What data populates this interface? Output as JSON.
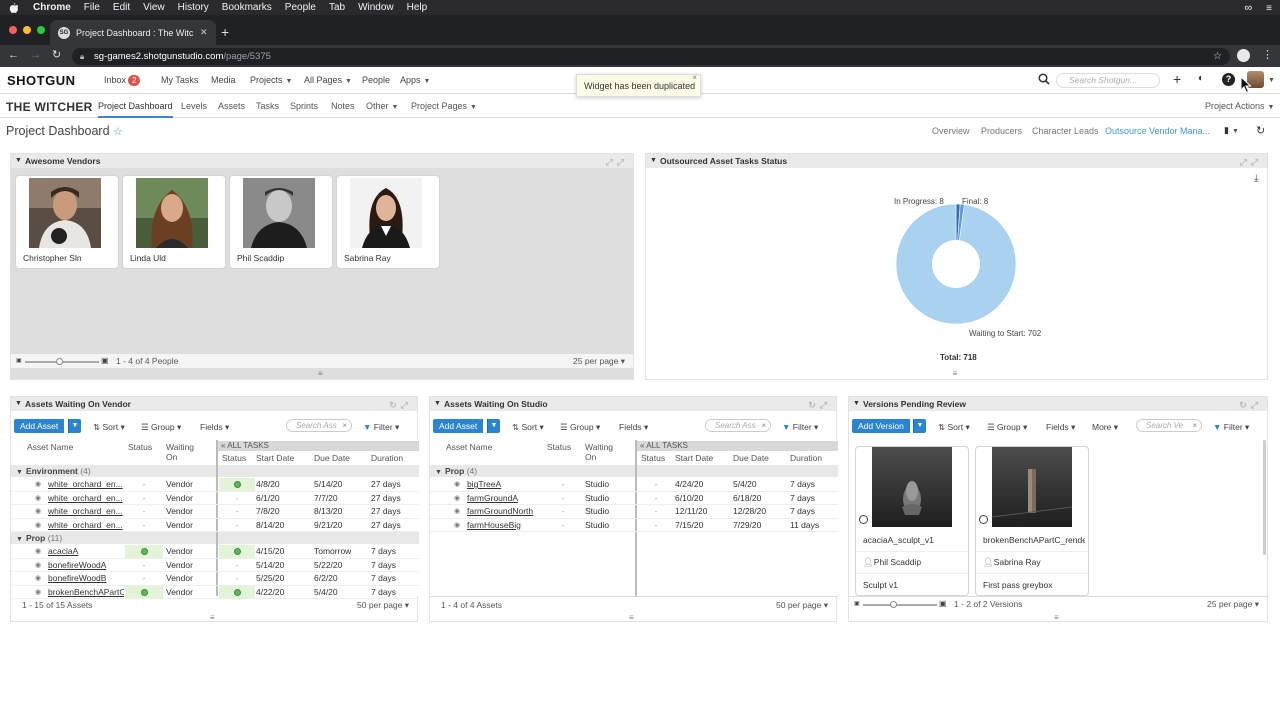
{
  "macos": {
    "app": "Chrome",
    "menus": [
      "File",
      "Edit",
      "View",
      "History",
      "Bookmarks",
      "People",
      "Tab",
      "Window",
      "Help"
    ]
  },
  "browser": {
    "tab_title": "Project Dashboard : The Witch",
    "favicon_text": "SG",
    "url_host": "sg-games2.shotgunstudio.com",
    "url_path": "/page/5375"
  },
  "app": {
    "logo": "SHOTGUN",
    "nav": [
      "Inbox",
      "My Tasks",
      "Media",
      "Projects",
      "All Pages",
      "People",
      "Apps"
    ],
    "inbox_count": "2",
    "search_placeholder": "Search Shotgun...",
    "toast": "Widget has been duplicated"
  },
  "project": {
    "title": "THE WITCHER",
    "tabs": [
      "Project Dashboard",
      "Levels",
      "Assets",
      "Tasks",
      "Sprints",
      "Notes",
      "Other",
      "Project Pages"
    ],
    "actions": "Project Actions"
  },
  "page": {
    "title": "Project Dashboard",
    "links": [
      "Overview",
      "Producers",
      "Character Leads",
      "Outsource Vendor Mana..."
    ]
  },
  "vendors_widget": {
    "title": "Awesome Vendors",
    "people": [
      "Christopher Sln",
      "Linda Uld",
      "Phil Scaddip",
      "Sabrina Ray"
    ],
    "footer_count": "1 - 4 of 4 People",
    "per_page": "25 per page"
  },
  "status_widget": {
    "title": "Outsourced Asset Tasks Status",
    "labels": {
      "in_progress": "In Progress: 8",
      "final": "Final: 8",
      "waiting": "Waiting to Start: 702"
    },
    "total": "Total: 718",
    "chart_data": {
      "type": "pie",
      "categories": [
        "In Progress",
        "Final",
        "Waiting to Start"
      ],
      "values": [
        8,
        8,
        702
      ],
      "colors": [
        "#2f6db5",
        "#5a9ad8",
        "#a9d1f0"
      ],
      "total": 718
    }
  },
  "toolbar": {
    "add_asset": "Add Asset",
    "add_version": "Add Version",
    "sort": "Sort",
    "group": "Group",
    "fields": "Fields",
    "more": "More",
    "filter": "Filter",
    "search_assets": "Search Ass",
    "search_versions": "Search Ve"
  },
  "vendor_assets": {
    "title": "Assets Waiting On Vendor",
    "headers": {
      "name": "Asset Name",
      "status": "Status",
      "waiting": "Waiting On",
      "all_tasks": "ALL TASKS",
      "t_status": "Status",
      "start": "Start Date",
      "due": "Due Date",
      "duration": "Duration"
    },
    "groups": [
      {
        "name": "Environment",
        "count": "(4)",
        "rows": [
          {
            "name": "white_orchard_en...",
            "status": "-",
            "waiting": "Vendor",
            "tstatus": "ok",
            "start": "4/8/20",
            "due": "5/14/20",
            "duration": "27 days"
          },
          {
            "name": "white_orchard_en...",
            "status": "-",
            "waiting": "Vendor",
            "tstatus": "-",
            "start": "6/1/20",
            "due": "7/7/20",
            "duration": "27 days"
          },
          {
            "name": "white_orchard_en...",
            "status": "-",
            "waiting": "Vendor",
            "tstatus": "-",
            "start": "7/8/20",
            "due": "8/13/20",
            "duration": "27 days"
          },
          {
            "name": "white_orchard_en...",
            "status": "-",
            "waiting": "Vendor",
            "tstatus": "-",
            "start": "8/14/20",
            "due": "9/21/20",
            "duration": "27 days"
          }
        ]
      },
      {
        "name": "Prop",
        "count": "(11)",
        "rows": [
          {
            "name": "acaciaA",
            "status": "ok",
            "waiting": "Vendor",
            "tstatus": "ok",
            "start": "4/15/20",
            "due": "Tomorrow",
            "duration": "7 days"
          },
          {
            "name": "bonefireWoodA",
            "status": "-",
            "waiting": "Vendor",
            "tstatus": "-",
            "start": "5/14/20",
            "due": "5/22/20",
            "duration": "7 days"
          },
          {
            "name": "bonefireWoodB",
            "status": "-",
            "waiting": "Vendor",
            "tstatus": "-",
            "start": "5/25/20",
            "due": "6/2/20",
            "duration": "7 days"
          },
          {
            "name": "brokenBenchAPartC",
            "status": "ok",
            "waiting": "Vendor",
            "tstatus": "ok",
            "start": "4/22/20",
            "due": "5/4/20",
            "duration": "7 days"
          }
        ]
      }
    ],
    "footer_count": "1 - 15 of 15 Assets",
    "per_page": "50 per page"
  },
  "studio_assets": {
    "title": "Assets Waiting On Studio",
    "headers": {
      "name": "Asset Name",
      "status": "Status",
      "waiting": "Waiting On",
      "all_tasks": "ALL TASKS",
      "t_status": "Status",
      "start": "Start Date",
      "due": "Due Date",
      "duration": "Duration"
    },
    "groups": [
      {
        "name": "Prop",
        "count": "(4)",
        "rows": [
          {
            "name": "bigTreeA",
            "status": "-",
            "waiting": "Studio",
            "tstatus": "-",
            "start": "4/24/20",
            "due": "5/4/20",
            "duration": "7 days"
          },
          {
            "name": "farmGroundA",
            "status": "-",
            "waiting": "Studio",
            "tstatus": "-",
            "start": "6/10/20",
            "due": "6/18/20",
            "duration": "7 days"
          },
          {
            "name": "farmGroundNorth",
            "status": "-",
            "waiting": "Studio",
            "tstatus": "-",
            "start": "12/11/20",
            "due": "12/28/20",
            "duration": "7 days"
          },
          {
            "name": "farmHouseBig",
            "status": "-",
            "waiting": "Studio",
            "tstatus": "-",
            "start": "7/15/20",
            "due": "7/29/20",
            "duration": "11 days"
          }
        ]
      }
    ],
    "footer_count": "1 - 4 of 4 Assets",
    "per_page": "50 per page"
  },
  "versions": {
    "title": "Versions Pending Review",
    "cards": [
      {
        "name": "acaciaA_sculpt_v1",
        "user": "Phil Scaddip",
        "desc": "Sculpt v1"
      },
      {
        "name": "brokenBenchAPartC_rende",
        "user": "Sabrina Ray",
        "desc": "First pass greybox"
      }
    ],
    "footer_count": "1 - 2 of 2 Versions",
    "per_page": "25 per page"
  }
}
